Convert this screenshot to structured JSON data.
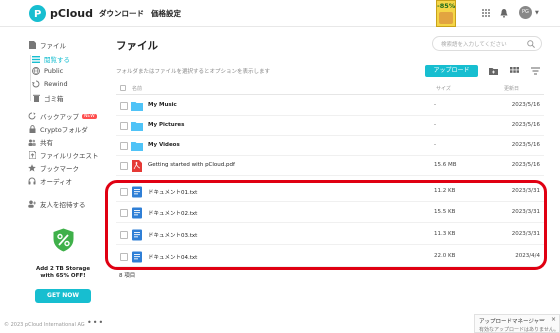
{
  "header": {
    "brand": "pCloud",
    "nav": [
      "ダウンロード",
      "価格設定"
    ],
    "ad_percent": "-85%",
    "avatar_initials": "PG"
  },
  "sidebar": {
    "files": "ファイル",
    "sub_items": [
      "閲覧する",
      "Public",
      "Rewind",
      "ゴミ箱"
    ],
    "items": [
      "バックアップ",
      "Cryptoフォルダ",
      "共有",
      "ファイルリクエスト",
      "ブックマーク",
      "オーディオ"
    ],
    "new_badge": "NEW",
    "invite": "友人を招待する",
    "promo_text": "Add 2 TB Storage with 65% OFF!",
    "promo_button": "GET NOW",
    "footer": "© 2023 pCloud International AG",
    "footer_more": "•••"
  },
  "main": {
    "title": "ファイル",
    "search_placeholder": "検索語を入力してください",
    "hint": "フォルダまたはファイルを選択するとオプションを表示します",
    "upload_button": "アップロード",
    "columns": {
      "name": "名前",
      "size": "サイズ",
      "modified": "更新日"
    },
    "rows": [
      {
        "name": "My Music",
        "size": "-",
        "date": "2023/5/16",
        "type": "folder"
      },
      {
        "name": "My Pictures",
        "size": "-",
        "date": "2023/5/16",
        "type": "folder"
      },
      {
        "name": "My Videos",
        "size": "-",
        "date": "2023/5/16",
        "type": "folder"
      },
      {
        "name": "Getting started with pCloud.pdf",
        "size": "15.6 MB",
        "date": "2023/5/16",
        "type": "pdf"
      },
      {
        "name": "ドキュメント01.txt",
        "size": "11.2 KB",
        "date": "2023/3/31",
        "type": "doc"
      },
      {
        "name": "ドキュメント02.txt",
        "size": "15.5 KB",
        "date": "2023/3/31",
        "type": "doc"
      },
      {
        "name": "ドキュメント03.txt",
        "size": "11.3 KB",
        "date": "2023/3/31",
        "type": "doc"
      },
      {
        "name": "ドキュメント04.txt",
        "size": "22.0 KB",
        "date": "2023/4/4",
        "type": "doc"
      }
    ],
    "count": "8 項目"
  },
  "upload_manager": {
    "title": "アップロードマネージャー",
    "status": "有効なアップロードはありません。",
    "minimize": "—",
    "close": "×"
  },
  "colors": {
    "accent": "#17bed0",
    "highlight": "#e00012",
    "pdf": "#e53935",
    "folder": "#4fc3f7"
  }
}
